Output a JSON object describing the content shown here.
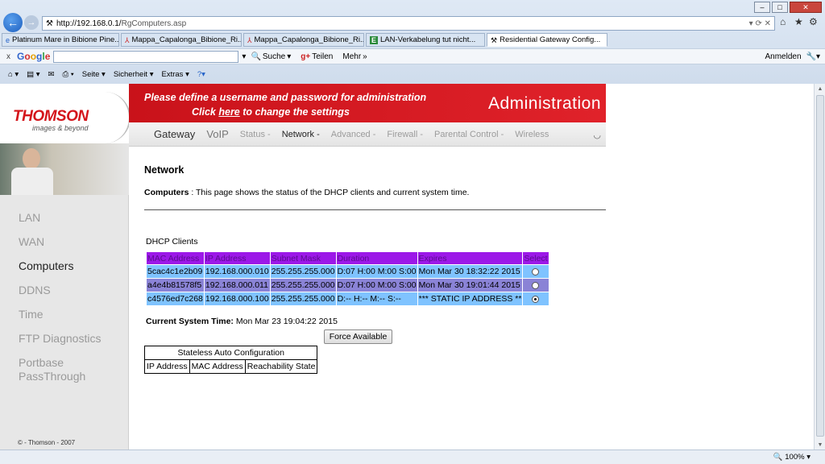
{
  "browser": {
    "url_host": "http://192.168.0.1/",
    "url_path": "RgComputers.asp",
    "window_buttons": [
      "–",
      "□",
      "✕"
    ],
    "tabs": [
      {
        "icon": "ie-icon",
        "label": "Platinum Mare in Bibione Pine..."
      },
      {
        "icon": "pdf-icon",
        "label": "Mappa_Capalonga_Bibione_Ri..."
      },
      {
        "icon": "pdf-icon",
        "label": "Mappa_Capalonga_Bibione_Ri..."
      },
      {
        "icon": "excel-icon",
        "label": "LAN-Verkabelung tut nicht..."
      },
      {
        "icon": "router-icon",
        "label": "Residential Gateway Config..."
      }
    ],
    "tab_close": "×",
    "google_bar": {
      "close": "x",
      "logo": [
        "G",
        "o",
        "o",
        "g",
        "l",
        "e"
      ],
      "search_label": "Suche",
      "share_label": "Teilen",
      "more_label": "Mehr",
      "signin": "Anmelden"
    },
    "command_bar": [
      "Seite",
      "Sicherheit",
      "Extras"
    ],
    "zoom": "100%"
  },
  "page": {
    "brand": "THOMSON",
    "brand_sub": "images & beyond",
    "banner_line1": "Please define a username and password for administration",
    "banner_line2_pre": "Click ",
    "banner_line2_link": "here",
    "banner_line2_post": " to change the settings",
    "banner_title": "Administration",
    "top_nav": [
      {
        "label": "Gateway"
      },
      {
        "label": "VoIP"
      },
      {
        "label": "Status -"
      },
      {
        "label": "Network -"
      },
      {
        "label": "Advanced -"
      },
      {
        "label": "Firewall -"
      },
      {
        "label": "Parental Control -"
      },
      {
        "label": "Wireless"
      }
    ],
    "left_nav": [
      "LAN",
      "WAN",
      "Computers",
      "DDNS",
      "Time",
      "FTP Diagnostics",
      "Portbase",
      "PassThrough"
    ],
    "copyright": "© - Thomson - 2007",
    "heading": "Network",
    "desc_label": "Computers",
    "desc_sep": " :  ",
    "desc_text": "This page shows the status of the DHCP clients and current system time.",
    "dhcp_title": "DHCP Clients",
    "dhcp_headers": [
      "MAC Address",
      "IP Address",
      "Subnet Mask",
      "Duration",
      "Expires",
      "Select"
    ],
    "dhcp_rows": [
      {
        "mac": "5cac4c1e2b09",
        "ip": "192.168.000.010",
        "mask": "255.255.255.000",
        "duration": "D:07 H:00 M:00 S:00",
        "expires": "Mon Mar 30 18:32:22 2015",
        "selected": false
      },
      {
        "mac": "a4e4b81578f5",
        "ip": "192.168.000.011",
        "mask": "255.255.255.000",
        "duration": "D:07 H:00 M:00 S:00",
        "expires": "Mon Mar 30 19:01:44 2015",
        "selected": false
      },
      {
        "mac": "c4576ed7c268",
        "ip": "192.168.000.100",
        "mask": "255.255.255.000",
        "duration": "D:-- H:-- M:-- S:--",
        "expires": "*** STATIC IP ADDRESS **",
        "selected": true
      }
    ],
    "systime_label": "Current System Time:",
    "systime_value": " Mon Mar 23 19:04:22 2015",
    "force_button": "Force Available",
    "sac_title": "Stateless Auto Configuration",
    "sac_headers": [
      "IP Address",
      "MAC Address",
      "Reachability State"
    ]
  }
}
